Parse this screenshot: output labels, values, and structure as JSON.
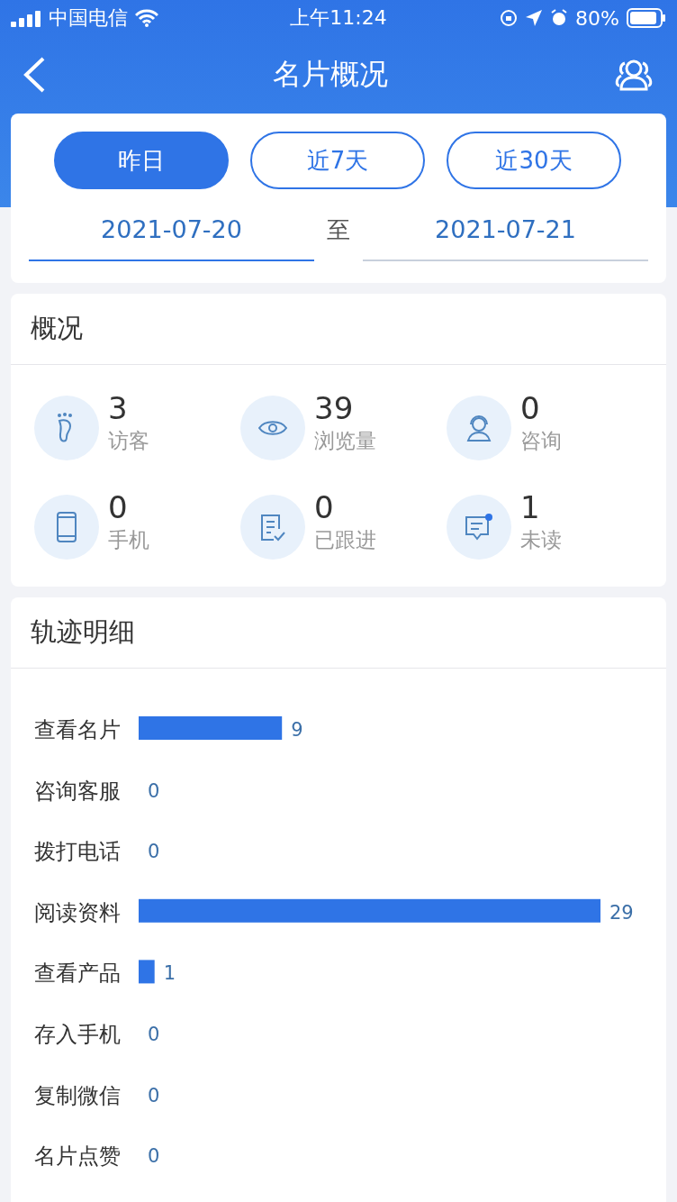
{
  "status_bar": {
    "carrier": "中国电信",
    "time": "上午11:24",
    "battery": "80%"
  },
  "nav": {
    "title": "名片概况"
  },
  "range_tabs": [
    {
      "label": "昨日",
      "selected": true
    },
    {
      "label": "近7天",
      "selected": false
    },
    {
      "label": "近30天",
      "selected": false
    }
  ],
  "date_range": {
    "start": "2021-07-20",
    "separator": "至",
    "end": "2021-07-21"
  },
  "overview": {
    "title": "概况",
    "stats": [
      {
        "kind": "foot",
        "value": "3",
        "label": "访客"
      },
      {
        "kind": "eye",
        "value": "39",
        "label": "浏览量"
      },
      {
        "kind": "agent",
        "value": "0",
        "label": "咨询"
      },
      {
        "kind": "phone",
        "value": "0",
        "label": "手机"
      },
      {
        "kind": "note",
        "value": "0",
        "label": "已跟进"
      },
      {
        "kind": "message",
        "value": "1",
        "label": "未读"
      }
    ]
  },
  "track": {
    "title": "轨迹明细",
    "chart_data": {
      "type": "bar",
      "orientation": "horizontal",
      "data_labels": true,
      "categories": [
        "查看名片",
        "咨询客服",
        "拨打电话",
        "阅读资料",
        "查看产品",
        "存入手机",
        "复制微信",
        "名片点赞"
      ],
      "series": [
        {
          "color": "#2f74e6",
          "values": [
            9,
            0,
            0,
            29,
            1,
            0,
            0,
            0
          ]
        }
      ]
    }
  }
}
